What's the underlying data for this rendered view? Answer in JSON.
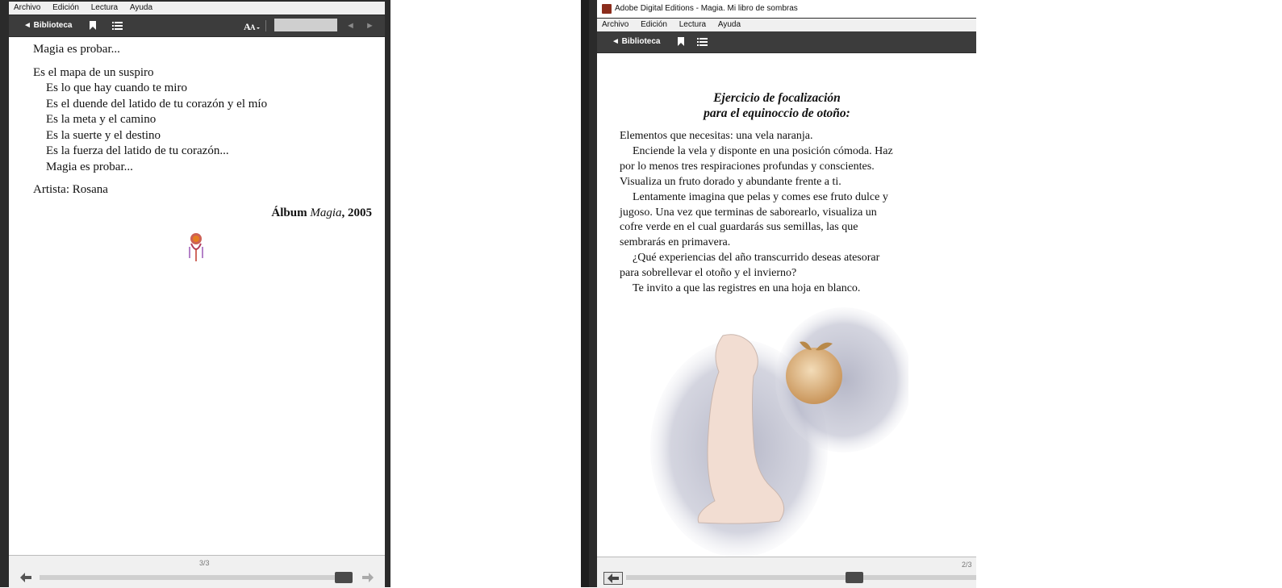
{
  "left_window": {
    "menu": [
      "Archivo",
      "Edición",
      "Lectura",
      "Ayuda"
    ],
    "toolbar": {
      "library_label": "◄ Biblioteca",
      "font_icon_label": "AA",
      "prev": "◄",
      "next": "►"
    },
    "content": {
      "line1": "Magia es probar...",
      "stanza": [
        "Es el mapa de un suspiro",
        "Es lo que hay cuando te miro",
        "Es el duende del latido de tu corazón y el mío",
        "Es la meta y el camino",
        "Es la suerte y el destino",
        "Es la fuerza del latido de tu corazón...",
        "Magia es probar..."
      ],
      "artist": "Artista: Rosana",
      "album_prefix": "Álbum ",
      "album_title": "Magia",
      "album_suffix": ", 2005"
    },
    "page_indicator": "3/3",
    "progress": 0.97
  },
  "right_window": {
    "title": "Adobe Digital Editions - Magia. Mi libro de sombras",
    "menu": [
      "Archivo",
      "Edición",
      "Lectura",
      "Ayuda"
    ],
    "toolbar": {
      "library_label": "◄ Biblioteca"
    },
    "content": {
      "heading1": "Ejercicio de focalización",
      "heading2": "para el equinoccio de otoño:",
      "lines": [
        "Elementos que necesitas: una vela naranja.",
        "Enciende la vela y disponte en una posición cómoda. Haz",
        "por lo menos tres respiraciones profundas y conscientes.",
        "Visualiza un fruto dorado y abundante frente a ti.",
        "Lentamente imagina que pelas y comes ese fruto dulce y",
        "jugoso. Una vez que terminas de saborearlo, visualiza un",
        "cofre verde en el cual guardarás sus semillas, las que",
        "sembrarás en primavera.",
        "¿Qué experiencias del año transcurrido deseas atesorar",
        "para sobrellevar el otoño y el invierno?",
        "Te invito a que las registres en una hoja en blanco."
      ],
      "indented": [
        false,
        true,
        false,
        false,
        true,
        false,
        false,
        false,
        true,
        false,
        true
      ]
    },
    "page_indicator": "2/3",
    "progress": 0.63
  }
}
